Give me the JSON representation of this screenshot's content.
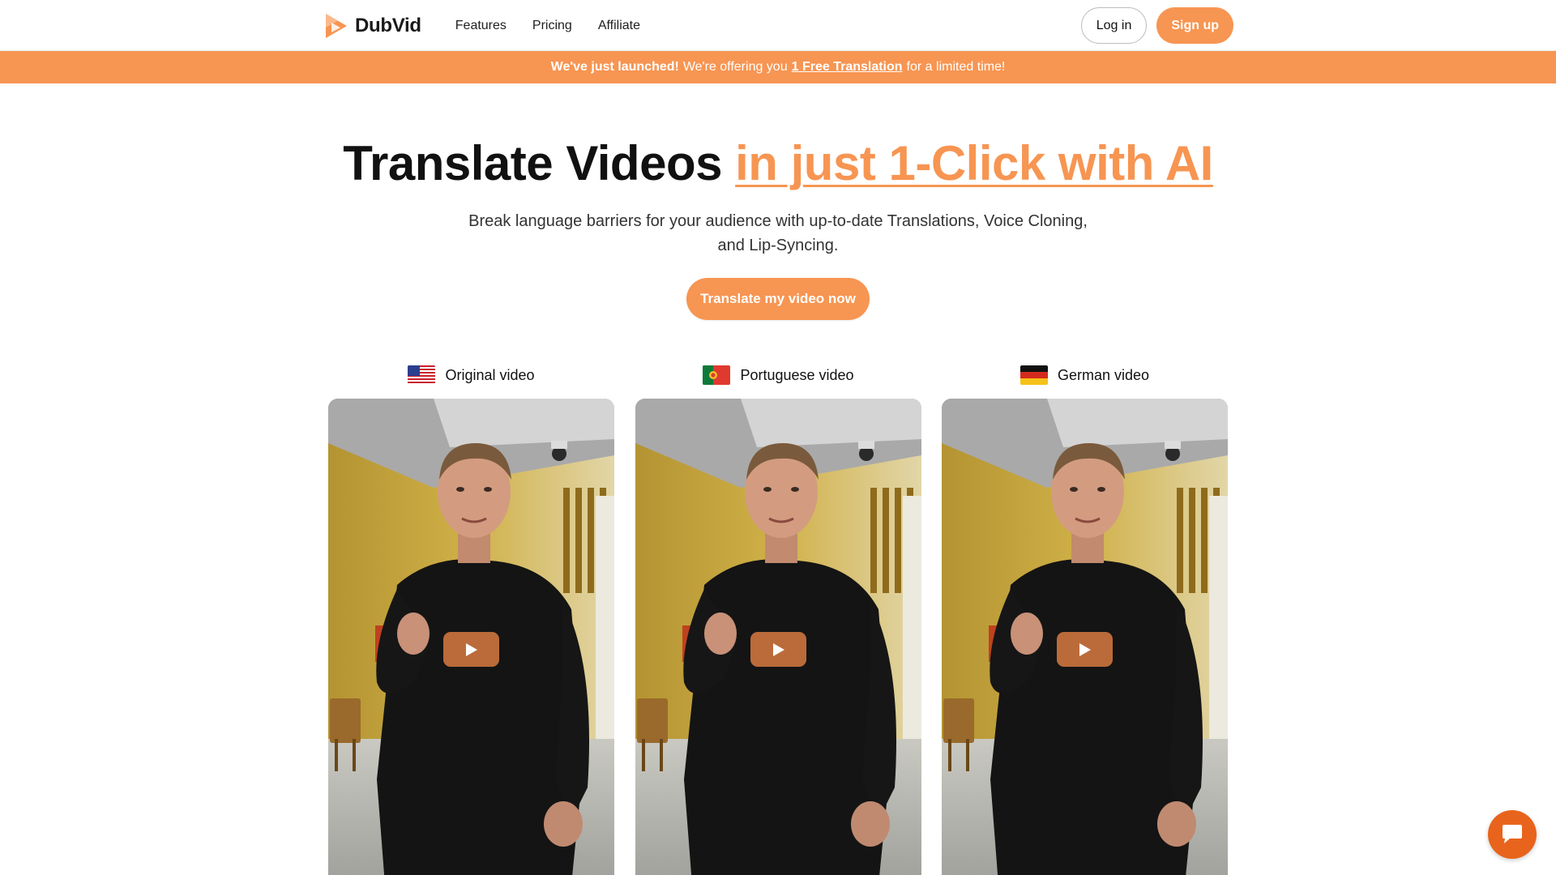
{
  "header": {
    "brand": "DubVid",
    "nav": [
      "Features",
      "Pricing",
      "Affiliate"
    ],
    "login": "Log in",
    "signup": "Sign up"
  },
  "announcement": {
    "bold": "We've just launched!",
    "before": "We're offering you",
    "link": "1 Free Translation",
    "after": "for a limited time!"
  },
  "hero": {
    "title_main": "Translate Videos",
    "title_highlight": "in just 1-Click with AI",
    "subtitle": "Break language barriers for your audience with up-to-date Translations, Voice Cloning, and Lip-Syncing.",
    "cta": "Translate my video now"
  },
  "videos": [
    {
      "label": "Original video",
      "flag": "us-flag-icon"
    },
    {
      "label": "Portuguese video",
      "flag": "portugal-flag-icon"
    },
    {
      "label": "German video",
      "flag": "germany-flag-icon"
    }
  ],
  "icons": {
    "play": "play-icon",
    "chat": "chat-icon"
  },
  "colors": {
    "accent": "#f79552",
    "play_button": "#c4703c",
    "chat_button": "#e8641c"
  }
}
